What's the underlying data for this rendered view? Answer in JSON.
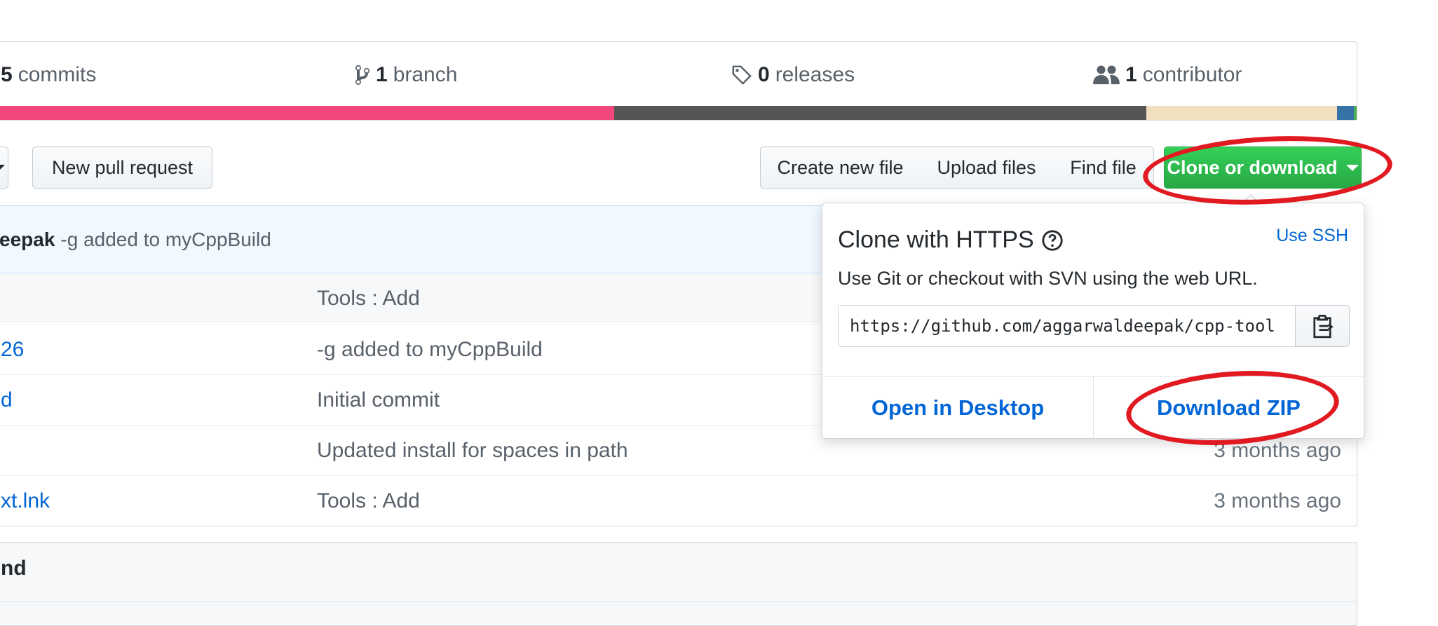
{
  "summary": {
    "commits_count": "5",
    "commits_label": "commits",
    "branch_count": "1",
    "branch_label": "branch",
    "releases_count": "0",
    "releases_label": "releases",
    "contributor_count": "1",
    "contributor_label": "contributor"
  },
  "language_colors": [
    "#f1477a",
    "#555555",
    "#f0e0c0",
    "#3572a5",
    "#4caf50"
  ],
  "toolbar": {
    "new_pull_request": "New pull request",
    "create_new_file": "Create new file",
    "upload_files": "Upload files",
    "find_file": "Find file",
    "clone_or_download": "Clone or download"
  },
  "latest_commit": {
    "author_partial": "eepak",
    "message": "-g added to myCppBuild"
  },
  "files": [
    {
      "name": "",
      "message": "Tools : Add",
      "age": ""
    },
    {
      "name": "26",
      "message": "-g added to myCppBuild",
      "age": ""
    },
    {
      "name": "d",
      "message": "Initial commit",
      "age": ""
    },
    {
      "name": "",
      "message": "Updated install for spaces in path",
      "age": "3 months ago"
    },
    {
      "name": "xt.lnk",
      "message": "Tools : Add",
      "age": "3 months ago"
    }
  ],
  "readme": {
    "title_partial": "nd"
  },
  "clone_panel": {
    "title": "Clone with HTTPS",
    "use_ssh": "Use SSH",
    "description": "Use Git or checkout with SVN using the web URL.",
    "url": "https://github.com/aggarwaldeepak/cpp-tool",
    "open_in_desktop": "Open in Desktop",
    "download_zip": "Download ZIP"
  },
  "annotation_color": "#e11a22",
  "accent_color": "#0366d6",
  "button_green": "#28a745"
}
